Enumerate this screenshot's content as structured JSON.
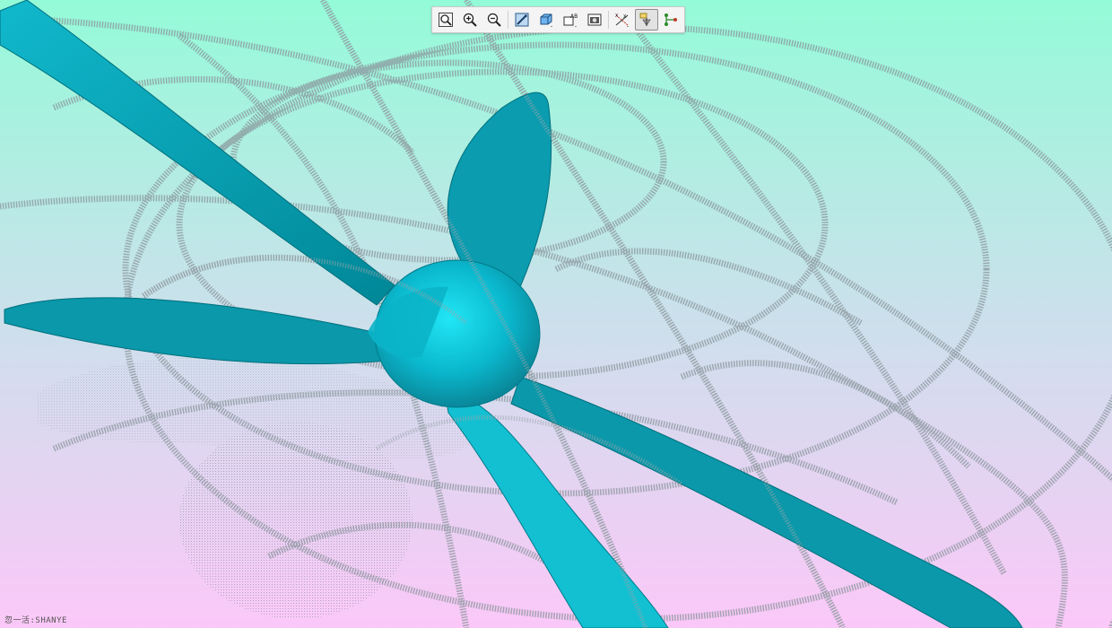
{
  "toolbar": {
    "buttons": [
      {
        "icon": "zoom-fit-icon",
        "tooltip": "Refit"
      },
      {
        "icon": "zoom-in-icon",
        "tooltip": "Zoom In"
      },
      {
        "icon": "zoom-out-icon",
        "tooltip": "Zoom Out"
      },
      {
        "icon": "repaint-icon",
        "tooltip": "Repaint"
      },
      {
        "icon": "display-style-icon",
        "tooltip": "Display Style"
      },
      {
        "icon": "saved-orientations-icon",
        "tooltip": "Saved Orientations"
      },
      {
        "icon": "view-manager-icon",
        "tooltip": "View Manager"
      },
      {
        "icon": "datum-display-icon",
        "tooltip": "Datum Display Filters"
      },
      {
        "icon": "annotation-display-icon",
        "tooltip": "Annotation Display"
      },
      {
        "icon": "spin-center-icon",
        "tooltip": "Spin Center"
      }
    ]
  },
  "watermark": "忽一活:SHANYE",
  "colors": {
    "background_top": "#94fbd8",
    "background_bottom": "#fbc8f8",
    "model": "#0aa9bd",
    "model_dark": "#008a9c",
    "wireframe": "#7d8a92"
  }
}
